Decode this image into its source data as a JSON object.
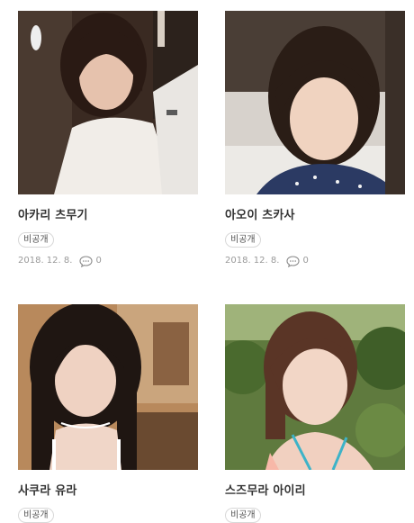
{
  "posts": [
    {
      "title": "아카리 츠무기",
      "tag": "비공개",
      "date": "2018. 12. 8.",
      "comments": "0",
      "icon": "comment-icon"
    },
    {
      "title": "아오이 츠카사",
      "tag": "비공개",
      "date": "2018. 12. 8.",
      "comments": "0",
      "icon": "comment-icon"
    },
    {
      "title": "사쿠라 유라",
      "tag": "비공개"
    },
    {
      "title": "스즈무라 아이리",
      "tag": "비공개"
    }
  ],
  "colors": {
    "tag_border": "#d8d8d8",
    "meta_text": "#9a9a9a",
    "title_text": "#333333"
  }
}
